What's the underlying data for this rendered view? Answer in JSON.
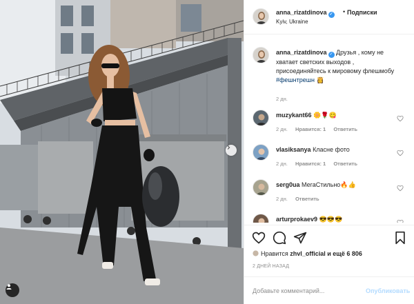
{
  "post": {
    "author": "anna_rizatdinova",
    "location": "Kyiv, Ukraine",
    "follow_label": "Подписки",
    "separator": "•",
    "caption_text": "Друзья , кому не хватает светских выходов , присоединяйтесь к мировому флешмобу",
    "caption_hashtag": "#фешнтрешн",
    "caption_emoji": "👸",
    "caption_time": "2 дн.",
    "likes_prefix": "Нравится",
    "likes_user": "zhvl_official",
    "likes_and": "и ещё 6 806",
    "time_ago": "2 ДНЕЙ НАЗАД"
  },
  "comments": [
    {
      "user": "muzykant66",
      "text": "🌼🌹😋",
      "time": "2 дн.",
      "likes": "Нравится: 1",
      "reply": "Ответить"
    },
    {
      "user": "vlasiksanya",
      "text": "Класне фото",
      "time": "2 дн.",
      "likes": "Нравится: 1",
      "reply": "Ответить"
    },
    {
      "user": "serg0ua",
      "text": "МегаСтильно🔥👍",
      "time": "2 дн.",
      "likes": "",
      "reply": "Ответить"
    },
    {
      "user": "arturprokaev9",
      "text": "😎😎😎",
      "time": "",
      "likes": "",
      "reply": ""
    }
  ],
  "add_comment": {
    "placeholder": "Добавьте комментарий...",
    "publish_label": "Опубликовать"
  },
  "colors": {
    "link_blue": "#00376b",
    "verified_blue": "#3897f0",
    "publish_disabled": "#b3dbff",
    "muted": "#8e8e8e"
  },
  "icons": [
    "heart-icon",
    "comment-icon",
    "share-icon",
    "bookmark-icon",
    "verified-icon",
    "user-tag-icon",
    "chevron-right-icon"
  ]
}
